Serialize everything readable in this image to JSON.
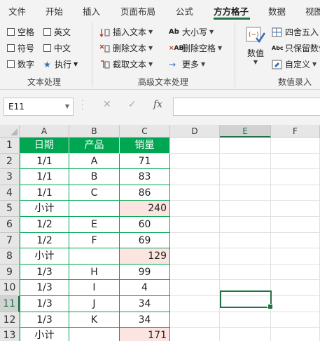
{
  "tabs": [
    "文件",
    "开始",
    "插入",
    "页面布局",
    "公式",
    "方方格子",
    "数据",
    "视图"
  ],
  "active_tab": "方方格子",
  "accent_color": "#217346",
  "text_processing": {
    "title": "文本处理",
    "checkboxes": [
      {
        "label": "空格",
        "checked": false
      },
      {
        "label": "英文",
        "checked": false
      },
      {
        "label": "符号",
        "checked": false
      },
      {
        "label": "中文",
        "checked": false
      },
      {
        "label": "数字",
        "checked": false
      }
    ],
    "execute_label": "执行"
  },
  "advanced_text": {
    "title": "高级文本处理",
    "insert_text": "插入文本",
    "delete_text": "删除文本",
    "cut_text": "截取文本",
    "case": "大小写",
    "delete_spaces": "删除空格",
    "more": "更多"
  },
  "numeric_entry": {
    "title": "数值录入",
    "value_button": "数值",
    "round": "四舍五入",
    "keep_digits": "只保留数值",
    "custom": "自定义"
  },
  "formula_bar": {
    "name_box": "E11",
    "fx": "fx",
    "cancel": "✕",
    "confirm": "✓",
    "formula": ""
  },
  "sheet": {
    "columns": [
      "A",
      "B",
      "C",
      "D",
      "E",
      "F"
    ],
    "selected_column": "E",
    "selected_row": "11",
    "rows": [
      {
        "n": "1",
        "a": "日期",
        "b": "产品",
        "c": "销量"
      },
      {
        "n": "2",
        "a": "1/1",
        "b": "A",
        "c": "71"
      },
      {
        "n": "3",
        "a": "1/1",
        "b": "B",
        "c": "83"
      },
      {
        "n": "4",
        "a": "1/1",
        "b": "C",
        "c": "86"
      },
      {
        "n": "5",
        "a": "小计",
        "b": "",
        "c": "240"
      },
      {
        "n": "6",
        "a": "1/2",
        "b": "E",
        "c": "60"
      },
      {
        "n": "7",
        "a": "1/2",
        "b": "F",
        "c": "69"
      },
      {
        "n": "8",
        "a": "小计",
        "b": "",
        "c": "129"
      },
      {
        "n": "9",
        "a": "1/3",
        "b": "H",
        "c": "99"
      },
      {
        "n": "10",
        "a": "1/3",
        "b": "I",
        "c": "4"
      },
      {
        "n": "11",
        "a": "1/3",
        "b": "J",
        "c": "34"
      },
      {
        "n": "12",
        "a": "1/3",
        "b": "K",
        "c": "34"
      },
      {
        "n": "13",
        "a": "小计",
        "b": "",
        "c": "171"
      }
    ]
  }
}
